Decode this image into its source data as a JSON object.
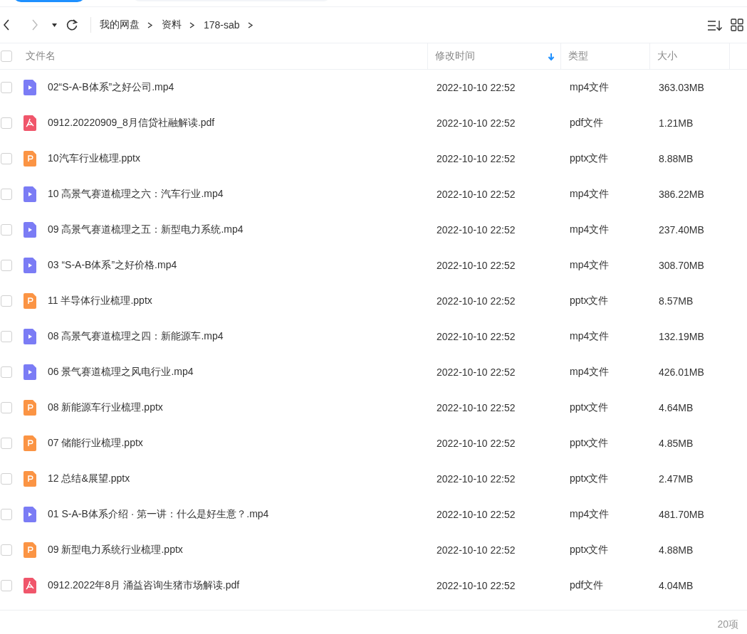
{
  "breadcrumb": [
    "我的网盘",
    "资料",
    "178-sab"
  ],
  "table": {
    "select_all": {
      "checked": false
    },
    "columns": [
      {
        "label": "文件名",
        "sorted": false
      },
      {
        "label": "修改时间",
        "sorted": true
      },
      {
        "label": "类型",
        "sorted": false
      },
      {
        "label": "大小",
        "sorted": false
      }
    ],
    "rows": [
      {
        "kind": "video",
        "name": "02“S-A-B体系”之好公司.mp4",
        "time": "2022-10-10 22:52",
        "type": "mp4文件",
        "size": "363.03MB",
        "checked": false
      },
      {
        "kind": "pdf",
        "name": "0912.20220909_8月信贷社融解读.pdf",
        "time": "2022-10-10 22:52",
        "type": "pdf文件",
        "size": "1.21MB",
        "checked": false
      },
      {
        "kind": "slides",
        "name": "10汽车行业梳理.pptx",
        "time": "2022-10-10 22:52",
        "type": "pptx文件",
        "size": "8.88MB",
        "checked": false
      },
      {
        "kind": "video",
        "name": "10 高景气赛道梳理之六：汽车行业.mp4",
        "time": "2022-10-10 22:52",
        "type": "mp4文件",
        "size": "386.22MB",
        "checked": false
      },
      {
        "kind": "video",
        "name": "09 高景气赛道梳理之五：新型电力系统.mp4",
        "time": "2022-10-10 22:52",
        "type": "mp4文件",
        "size": "237.40MB",
        "checked": false
      },
      {
        "kind": "video",
        "name": "03 “S-A-B体系”之好价格.mp4",
        "time": "2022-10-10 22:52",
        "type": "mp4文件",
        "size": "308.70MB",
        "checked": false
      },
      {
        "kind": "slides",
        "name": "11 半导体行业梳理.pptx",
        "time": "2022-10-10 22:52",
        "type": "pptx文件",
        "size": "8.57MB",
        "checked": false
      },
      {
        "kind": "video",
        "name": "08 高景气赛道梳理之四：新能源车.mp4",
        "time": "2022-10-10 22:52",
        "type": "mp4文件",
        "size": "132.19MB",
        "checked": false
      },
      {
        "kind": "video",
        "name": "06 景气赛道梳理之风电行业.mp4",
        "time": "2022-10-10 22:52",
        "type": "mp4文件",
        "size": "426.01MB",
        "checked": false
      },
      {
        "kind": "slides",
        "name": "08 新能源车行业梳理.pptx",
        "time": "2022-10-10 22:52",
        "type": "pptx文件",
        "size": "4.64MB",
        "checked": false
      },
      {
        "kind": "slides",
        "name": "07 储能行业梳理.pptx",
        "time": "2022-10-10 22:52",
        "type": "pptx文件",
        "size": "4.85MB",
        "checked": false
      },
      {
        "kind": "slides",
        "name": "12 总结&展望.pptx",
        "time": "2022-10-10 22:52",
        "type": "pptx文件",
        "size": "2.47MB",
        "checked": false
      },
      {
        "kind": "video",
        "name": "01 S-A-B体系介绍 · 第一讲：什么是好生意？.mp4",
        "time": "2022-10-10 22:52",
        "type": "mp4文件",
        "size": "481.70MB",
        "checked": false
      },
      {
        "kind": "slides",
        "name": "09 新型电力系统行业梳理.pptx",
        "time": "2022-10-10 22:52",
        "type": "pptx文件",
        "size": "4.88MB",
        "checked": false
      },
      {
        "kind": "pdf",
        "name": "0912.2022年8月 涌益咨询生猪市场解读.pdf",
        "time": "2022-10-10 22:52",
        "type": "pdf文件",
        "size": "4.04MB",
        "checked": false
      }
    ]
  },
  "status_bar": {
    "count": "20项"
  }
}
